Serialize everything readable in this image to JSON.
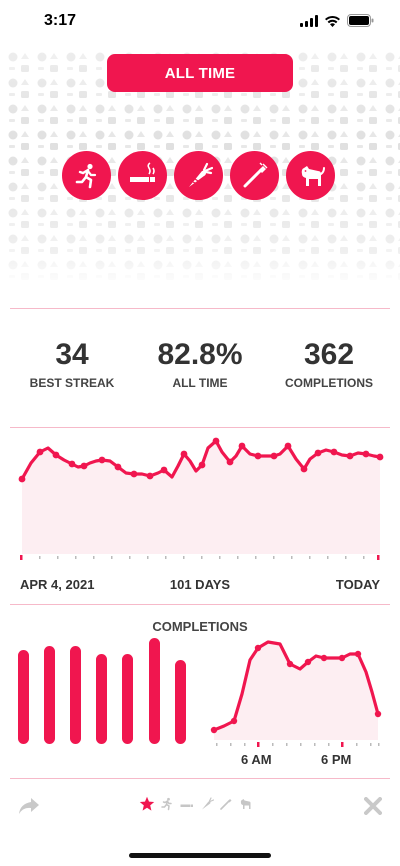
{
  "status": {
    "time": "3:17"
  },
  "header": {
    "button_label": "ALL TIME"
  },
  "habits": [
    {
      "name": "running",
      "icon": "runner-icon"
    },
    {
      "name": "no-smoking",
      "icon": "cigarette-icon"
    },
    {
      "name": "vegetables",
      "icon": "carrot-icon"
    },
    {
      "name": "toothbrush",
      "icon": "toothbrush-icon"
    },
    {
      "name": "dog",
      "icon": "dog-icon"
    }
  ],
  "stats": [
    {
      "value": "34",
      "label": "BEST STREAK"
    },
    {
      "value": "82.8%",
      "label": "ALL TIME"
    },
    {
      "value": "362",
      "label": "COMPLETIONS"
    }
  ],
  "trend": {
    "start_label": "APR 4, 2021",
    "duration_label": "101 DAYS",
    "end_label": "TODAY"
  },
  "completions": {
    "title": "COMPLETIONS",
    "time_labels": [
      "6 AM",
      "6 PM"
    ]
  },
  "colors": {
    "accent": "#f0164f",
    "fill": "#fdeef2",
    "divider": "#f6b9c9"
  },
  "toolbar": {
    "share_icon": "share-icon",
    "close_icon": "close-icon",
    "page_icons": [
      "star-icon",
      "runner-icon",
      "cigarette-icon",
      "carrot-icon",
      "toothbrush-icon",
      "dog-icon"
    ]
  }
}
